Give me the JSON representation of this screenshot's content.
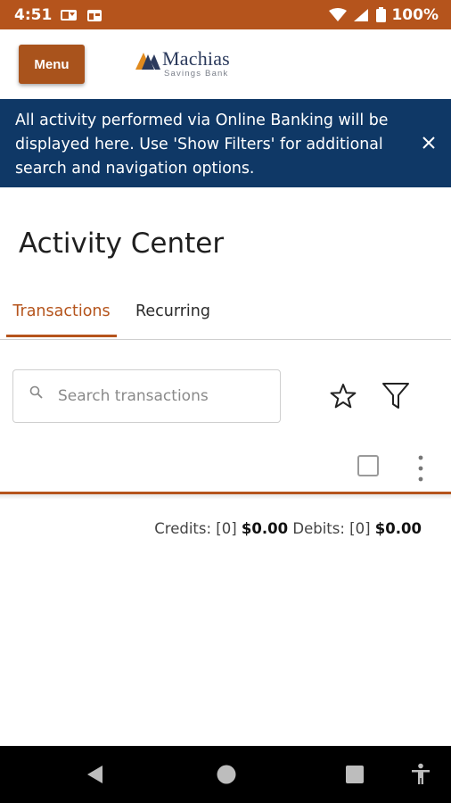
{
  "status_bar": {
    "time": "4:51",
    "battery": "100%",
    "notification_icons": [
      "outlook-icon",
      "calendar-icon"
    ],
    "system_icons": [
      "wifi-icon",
      "signal-icon",
      "battery-icon"
    ]
  },
  "header": {
    "menu_label": "Menu",
    "logo_name": "Machias",
    "logo_subtitle": "Savings Bank"
  },
  "banner": {
    "message": "All activity performed via Online Banking will be displayed here. Use 'Show Filters' for additional search and navigation options."
  },
  "page": {
    "title": "Activity Center"
  },
  "tabs": [
    {
      "label": "Transactions",
      "active": true
    },
    {
      "label": "Recurring",
      "active": false
    }
  ],
  "search": {
    "placeholder": "Search transactions",
    "value": ""
  },
  "toolbar": {
    "icons": [
      "star-icon",
      "filter-icon",
      "checkbox",
      "more-vertical-icon"
    ]
  },
  "totals": {
    "credits_label": "Credits:",
    "credits_count": "[0]",
    "credits_amount": "$0.00",
    "debits_label": "Debits:",
    "debits_count": "[0]",
    "debits_amount": "$0.00"
  },
  "nav_bar": {
    "icons": [
      "back-icon",
      "home-icon",
      "recents-icon",
      "accessibility-icon"
    ]
  },
  "colors": {
    "brand_orange": "#b5541c",
    "banner_navy": "#0f3866",
    "nav_bar": "#000000"
  }
}
